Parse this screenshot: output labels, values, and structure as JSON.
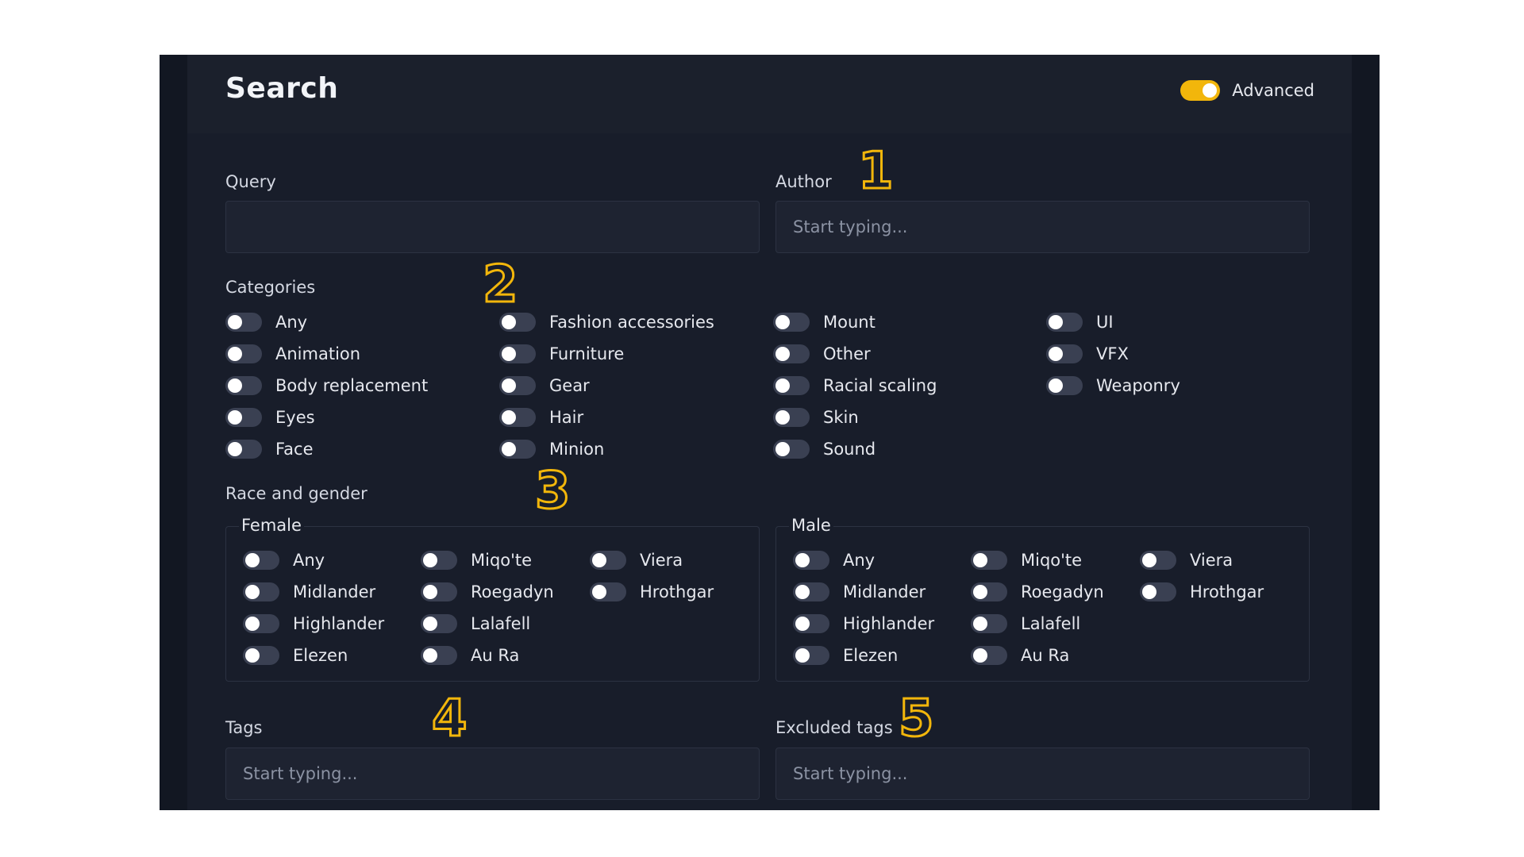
{
  "header": {
    "title": "Search",
    "advanced_label": "Advanced",
    "advanced_on": true
  },
  "query": {
    "label": "Query",
    "value": "",
    "placeholder": ""
  },
  "author": {
    "label": "Author",
    "placeholder": "Start typing..."
  },
  "categories": {
    "label": "Categories",
    "columns": [
      [
        "Any",
        "Animation",
        "Body replacement",
        "Eyes",
        "Face"
      ],
      [
        "Fashion accessories",
        "Furniture",
        "Gear",
        "Hair",
        "Minion"
      ],
      [
        "Mount",
        "Other",
        "Racial scaling",
        "Skin",
        "Sound"
      ],
      [
        "UI",
        "VFX",
        "Weaponry"
      ]
    ]
  },
  "race_gender": {
    "label": "Race and gender",
    "female": {
      "legend": "Female",
      "columns": [
        [
          "Any",
          "Midlander",
          "Highlander",
          "Elezen"
        ],
        [
          "Miqo'te",
          "Roegadyn",
          "Lalafell",
          "Au Ra"
        ],
        [
          "Viera",
          "Hrothgar"
        ]
      ]
    },
    "male": {
      "legend": "Male",
      "columns": [
        [
          "Any",
          "Midlander",
          "Highlander",
          "Elezen"
        ],
        [
          "Miqo'te",
          "Roegadyn",
          "Lalafell",
          "Au Ra"
        ],
        [
          "Viera",
          "Hrothgar"
        ]
      ]
    }
  },
  "tags": {
    "label": "Tags",
    "placeholder": "Start typing..."
  },
  "excluded_tags": {
    "label": "Excluded tags",
    "placeholder": "Start typing..."
  },
  "annotations": [
    "1",
    "2",
    "3",
    "4",
    "5"
  ],
  "colors": {
    "accent": "#f2b60b",
    "panel": "#181d2a",
    "frame": "#121722",
    "toggle_off": "#3a4052"
  }
}
